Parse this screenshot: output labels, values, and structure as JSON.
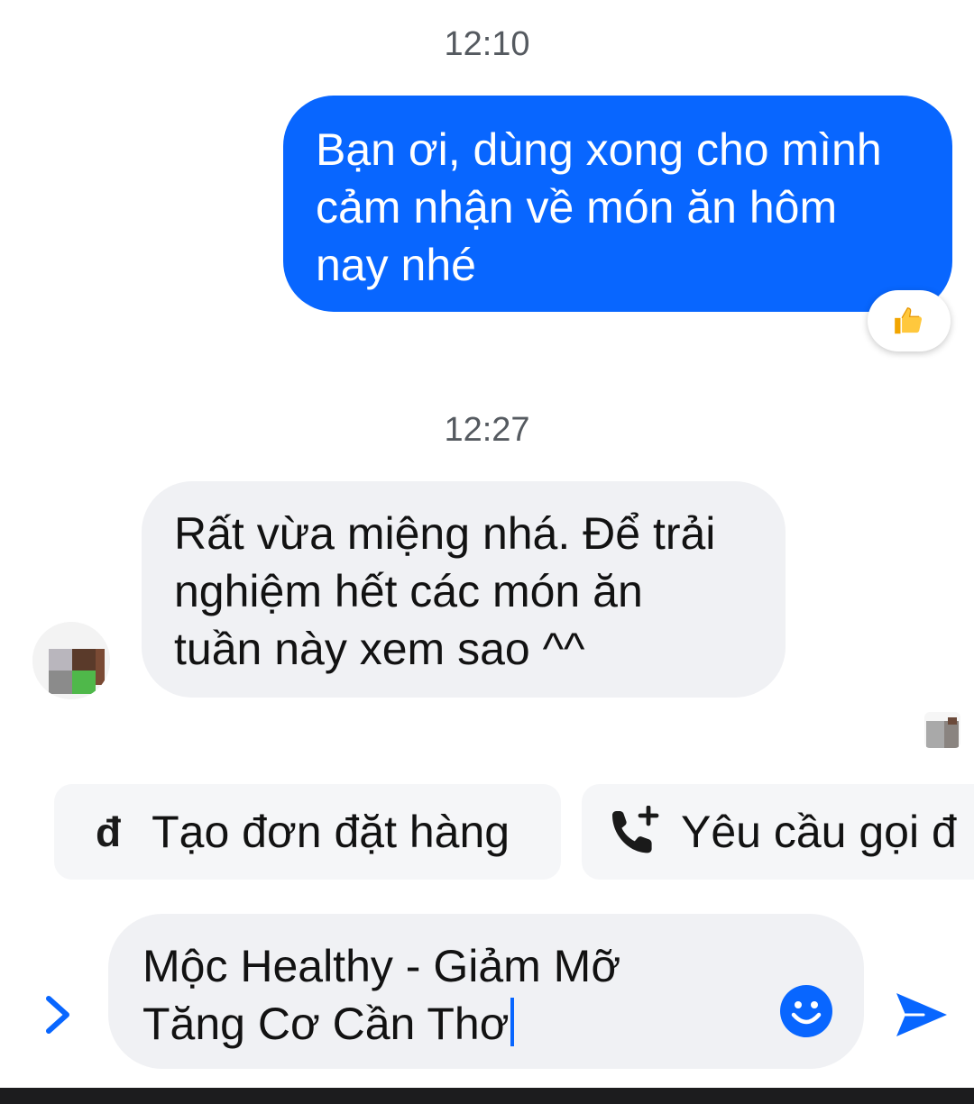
{
  "conversation": {
    "timestamps": [
      "12:10",
      "12:27"
    ],
    "outgoing_message": "Bạn ơi, dùng xong cho mình\ncảm nhận về món ăn hôm\nnay nhé",
    "outgoing_reaction": "thumbs-up",
    "incoming_message": "Rất vừa miệng nhá. Để trải\nnghiệm hết các món ăn\ntuần này xem sao ^^"
  },
  "quick_actions": [
    {
      "icon": "đ",
      "label": "Tạo đơn đặt hàng"
    },
    {
      "icon": "phone-add-icon",
      "label": "Yêu cầu gọi đ"
    }
  ],
  "composer": {
    "value": "Mộc Healthy - Giảm Mỡ\nTăng Cơ Cần Thơ"
  },
  "colors": {
    "accent": "#0866ff",
    "outgoing_bubble": "#0866ff",
    "incoming_bubble": "#f0f1f4",
    "timestamp": "#555a60"
  }
}
